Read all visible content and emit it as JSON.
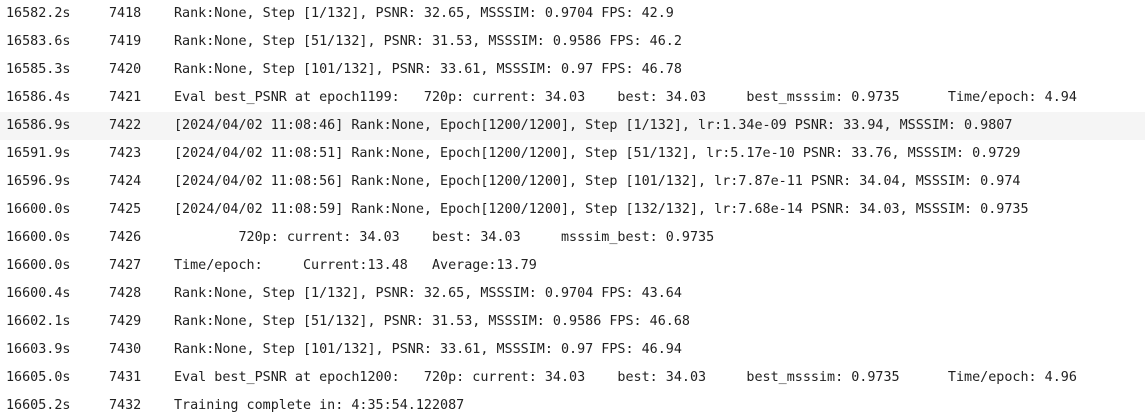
{
  "log": {
    "highlighted_index": 4,
    "rows": [
      {
        "time": "16582.2s",
        "line": "7418",
        "text": "Rank:None, Step [1/132], PSNR: 32.65, MSSSIM: 0.9704 FPS: 42.9"
      },
      {
        "time": "16583.6s",
        "line": "7419",
        "text": "Rank:None, Step [51/132], PSNR: 31.53, MSSSIM: 0.9586 FPS: 46.2"
      },
      {
        "time": "16585.3s",
        "line": "7420",
        "text": "Rank:None, Step [101/132], PSNR: 33.61, MSSSIM: 0.97 FPS: 46.78"
      },
      {
        "time": "16586.4s",
        "line": "7421",
        "text": "Eval best_PSNR at epoch1199:   720p: current: 34.03    best: 34.03     best_msssim: 0.9735      Time/epoch: 4.94"
      },
      {
        "time": "16586.9s",
        "line": "7422",
        "text": "[2024/04/02 11:08:46] Rank:None, Epoch[1200/1200], Step [1/132], lr:1.34e-09 PSNR: 33.94, MSSSIM: 0.9807"
      },
      {
        "time": "16591.9s",
        "line": "7423",
        "text": "[2024/04/02 11:08:51] Rank:None, Epoch[1200/1200], Step [51/132], lr:5.17e-10 PSNR: 33.76, MSSSIM: 0.9729"
      },
      {
        "time": "16596.9s",
        "line": "7424",
        "text": "[2024/04/02 11:08:56] Rank:None, Epoch[1200/1200], Step [101/132], lr:7.87e-11 PSNR: 34.04, MSSSIM: 0.974"
      },
      {
        "time": "16600.0s",
        "line": "7425",
        "text": "[2024/04/02 11:08:59] Rank:None, Epoch[1200/1200], Step [132/132], lr:7.68e-14 PSNR: 34.03, MSSSIM: 0.9735"
      },
      {
        "time": "16600.0s",
        "line": "7426",
        "text": "        720p: current: 34.03    best: 34.03     msssim_best: 0.9735"
      },
      {
        "time": "16600.0s",
        "line": "7427",
        "text": "Time/epoch:     Current:13.48   Average:13.79"
      },
      {
        "time": "16600.4s",
        "line": "7428",
        "text": "Rank:None, Step [1/132], PSNR: 32.65, MSSSIM: 0.9704 FPS: 43.64"
      },
      {
        "time": "16602.1s",
        "line": "7429",
        "text": "Rank:None, Step [51/132], PSNR: 31.53, MSSSIM: 0.9586 FPS: 46.68"
      },
      {
        "time": "16603.9s",
        "line": "7430",
        "text": "Rank:None, Step [101/132], PSNR: 33.61, MSSSIM: 0.97 FPS: 46.94"
      },
      {
        "time": "16605.0s",
        "line": "7431",
        "text": "Eval best_PSNR at epoch1200:   720p: current: 34.03    best: 34.03     best_msssim: 0.9735      Time/epoch: 4.96"
      },
      {
        "time": "16605.2s",
        "line": "7432",
        "text": "Training complete in: 4:35:54.122087"
      }
    ]
  }
}
